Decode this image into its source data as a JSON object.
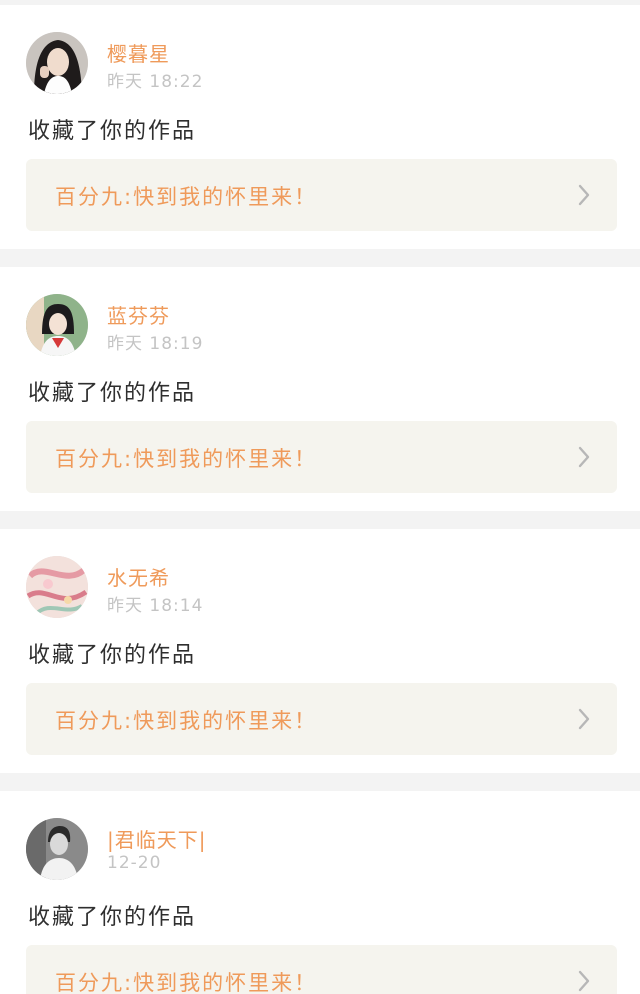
{
  "notifications": [
    {
      "user_name": "樱暮星",
      "time": "昨天  18:22",
      "action": "收藏了你的作品",
      "work_title": "百分九:快到我的怀里来！",
      "avatar_icon": "avatar-girl-dark-hair"
    },
    {
      "user_name": "蓝芬芬",
      "time": "昨天  18:19",
      "action": "收藏了你的作品",
      "work_title": "百分九:快到我的怀里来！",
      "avatar_icon": "avatar-girl-sailor-uniform"
    },
    {
      "user_name": "水无希",
      "time": "昨天  18:14",
      "action": "收藏了你的作品",
      "work_title": "百分九:快到我的怀里来！",
      "avatar_icon": "avatar-pink-illustration"
    },
    {
      "user_name": "|君临天下|",
      "time": "12-20",
      "action": "收藏了你的作品",
      "work_title": "百分九:快到我的怀里来！",
      "avatar_icon": "avatar-man-grayscale"
    }
  ],
  "colors": {
    "accent": "#ef9a5a",
    "muted_text": "#c4c4c4",
    "body_text": "#2f2f2f",
    "link_background": "#f5f4ee",
    "page_background": "#f3f3f3",
    "card_background": "#ffffff"
  }
}
